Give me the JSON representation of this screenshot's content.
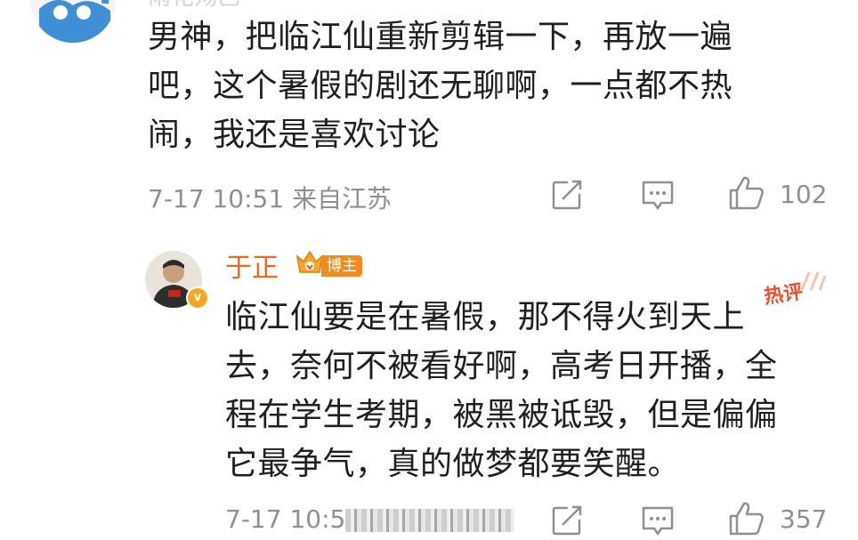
{
  "top_comment": {
    "username_partial": "雨花殇巴",
    "paragraph": [
      "男神，把临江仙重新剪辑一下，再放一遍",
      "吧，这个暑假的剧还无聊啊，一点都不热",
      "闹，我还是喜欢讨论"
    ],
    "date": "7-17",
    "time": "10:51",
    "location": "来自江苏",
    "like_count": "102",
    "icons": [
      "share-icon",
      "comment-icon",
      "like-icon"
    ]
  },
  "reply": {
    "username": "于正",
    "badge": "博主",
    "verified_badge": "v",
    "hot_label": "热评",
    "paragraph": [
      "临江仙要是在暑假，那不得火到天上",
      "去，奈何不被看好啊，高考日开播，全",
      "程在学生考期，被黑被诋毁，但是偏偏",
      "它最争气，真的做梦都要笑醒。"
    ],
    "date": "7-17",
    "time_partial": "10:5",
    "like_count": "357",
    "icons": [
      "share-icon",
      "comment-icon",
      "like-icon"
    ]
  },
  "colors": {
    "username": "#ea6a1a",
    "meta_gray": "#8f8f8f",
    "badge_orange": "#f08c1e",
    "hot_red": "#e8522d"
  }
}
